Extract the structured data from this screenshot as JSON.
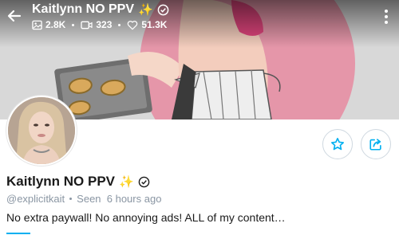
{
  "header": {
    "title": "Kaitlynn NO PPV",
    "title_emoji": "✨",
    "stats": {
      "photos": "2.8K",
      "videos": "323",
      "likes": "51.3K"
    }
  },
  "profile": {
    "display_name": "Kaitlynn NO PPV",
    "name_emoji": "✨",
    "username": "@explicitkait",
    "last_seen": "Seen  6 hours ago",
    "bio": "No extra paywall! No annoying ads! ALL of my content…"
  },
  "colors": {
    "accent": "#00aff0",
    "muted": "#8a96a3",
    "cover_pink": "#e9a3b4"
  },
  "icons": {
    "back": "arrow-left-icon",
    "verified": "verified-badge-icon",
    "photos": "image-icon",
    "videos": "video-icon",
    "likes": "heart-icon",
    "more": "more-vertical-icon",
    "favorite": "star-icon",
    "share": "share-icon"
  }
}
